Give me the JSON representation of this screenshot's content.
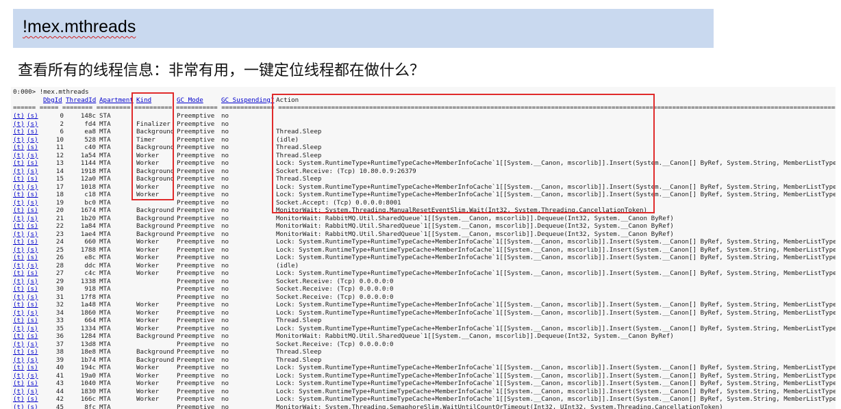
{
  "slide": {
    "title": "!mex.mthreads",
    "subtitle": "查看所有的线程信息：非常有用，一键定位线程都在做什么？"
  },
  "console": {
    "prompt": "0:000> !mex.mthreads",
    "headers": {
      "dbgid": "DbgId",
      "threadid": "ThreadId",
      "apartment": "Apartment",
      "kind": "Kind",
      "gcmode": "GC Mode",
      "gcsuspending": "GC Suspending?",
      "action": "Action"
    },
    "link_t": "(t)",
    "link_s": "(s)",
    "rows": [
      {
        "dbg": "0",
        "tid": "148c",
        "apt": "STA",
        "kind": "",
        "gc": "Preemptive",
        "susp": "no",
        "action": ""
      },
      {
        "dbg": "2",
        "tid": "fd4",
        "apt": "MTA",
        "kind": "Finalizer",
        "gc": "Preemptive",
        "susp": "no",
        "action": ""
      },
      {
        "dbg": "6",
        "tid": "ea8",
        "apt": "MTA",
        "kind": "Background",
        "gc": "Preemptive",
        "susp": "no",
        "action": "Thread.Sleep"
      },
      {
        "dbg": "10",
        "tid": "528",
        "apt": "MTA",
        "kind": "Timer",
        "gc": "Preemptive",
        "susp": "no",
        "action": "(idle)"
      },
      {
        "dbg": "11",
        "tid": "c40",
        "apt": "MTA",
        "kind": "Background",
        "gc": "Preemptive",
        "susp": "no",
        "action": "Thread.Sleep"
      },
      {
        "dbg": "12",
        "tid": "1a54",
        "apt": "MTA",
        "kind": "Worker",
        "gc": "Preemptive",
        "susp": "no",
        "action": "Thread.Sleep"
      },
      {
        "dbg": "13",
        "tid": "1144",
        "apt": "MTA",
        "kind": "Worker",
        "gc": "Preemptive",
        "susp": "no",
        "action": "Lock: System.RuntimeType+RuntimeTypeCache+MemberInfoCache`1[[System.__Canon, mscorlib]].Insert(System.__Canon[] ByRef, System.String, MemberListType)"
      },
      {
        "dbg": "14",
        "tid": "1918",
        "apt": "MTA",
        "kind": "Background",
        "gc": "Preemptive",
        "susp": "no",
        "action": "Socket.Receive: (Tcp) 10.80.0.9:26379"
      },
      {
        "dbg": "15",
        "tid": "12a0",
        "apt": "MTA",
        "kind": "Background",
        "gc": "Preemptive",
        "susp": "no",
        "action": "Thread.Sleep"
      },
      {
        "dbg": "17",
        "tid": "1018",
        "apt": "MTA",
        "kind": "Worker",
        "gc": "Preemptive",
        "susp": "no",
        "action": "Lock: System.RuntimeType+RuntimeTypeCache+MemberInfoCache`1[[System.__Canon, mscorlib]].Insert(System.__Canon[] ByRef, System.String, MemberListType)"
      },
      {
        "dbg": "18",
        "tid": "c18",
        "apt": "MTA",
        "kind": "Worker",
        "gc": "Preemptive",
        "susp": "no",
        "action": "Lock: System.RuntimeType+RuntimeTypeCache+MemberInfoCache`1[[System.__Canon, mscorlib]].Insert(System.__Canon[] ByRef, System.String, MemberListType)"
      },
      {
        "dbg": "19",
        "tid": "bc0",
        "apt": "MTA",
        "kind": "",
        "gc": "Preemptive",
        "susp": "no",
        "action": "Socket.Accept: (Tcp) 0.0.0.0:8001"
      },
      {
        "dbg": "20",
        "tid": "1674",
        "apt": "MTA",
        "kind": "Background",
        "gc": "Preemptive",
        "susp": "no",
        "action": "MonitorWait: System.Threading.ManualResetEventSlim.Wait(Int32, System.Threading.CancellationToken)"
      },
      {
        "dbg": "21",
        "tid": "1b20",
        "apt": "MTA",
        "kind": "Background",
        "gc": "Preemptive",
        "susp": "no",
        "action": "MonitorWait: RabbitMQ.Util.SharedQueue`1[[System.__Canon, mscorlib]].Dequeue(Int32, System.__Canon ByRef)"
      },
      {
        "dbg": "22",
        "tid": "1a84",
        "apt": "MTA",
        "kind": "Background",
        "gc": "Preemptive",
        "susp": "no",
        "action": "MonitorWait: RabbitMQ.Util.SharedQueue`1[[System.__Canon, mscorlib]].Dequeue(Int32, System.__Canon ByRef)"
      },
      {
        "dbg": "23",
        "tid": "1ae4",
        "apt": "MTA",
        "kind": "Background",
        "gc": "Preemptive",
        "susp": "no",
        "action": "MonitorWait: RabbitMQ.Util.SharedQueue`1[[System.__Canon, mscorlib]].Dequeue(Int32, System.__Canon ByRef)"
      },
      {
        "dbg": "24",
        "tid": "660",
        "apt": "MTA",
        "kind": "Worker",
        "gc": "Preemptive",
        "susp": "no",
        "action": "Lock: System.RuntimeType+RuntimeTypeCache+MemberInfoCache`1[[System.__Canon, mscorlib]].Insert(System.__Canon[] ByRef, System.String, MemberListType)"
      },
      {
        "dbg": "25",
        "tid": "1788",
        "apt": "MTA",
        "kind": "Worker",
        "gc": "Preemptive",
        "susp": "no",
        "action": "Lock: System.RuntimeType+RuntimeTypeCache+MemberInfoCache`1[[System.__Canon, mscorlib]].Insert(System.__Canon[] ByRef, System.String, MemberListType)"
      },
      {
        "dbg": "26",
        "tid": "e8c",
        "apt": "MTA",
        "kind": "Worker",
        "gc": "Preemptive",
        "susp": "no",
        "action": "Lock: System.RuntimeType+RuntimeTypeCache+MemberInfoCache`1[[System.__Canon, mscorlib]].Insert(System.__Canon[] ByRef, System.String, MemberListType)"
      },
      {
        "dbg": "28",
        "tid": "ddc",
        "apt": "MTA",
        "kind": "Worker",
        "gc": "Preemptive",
        "susp": "no",
        "action": "(idle)"
      },
      {
        "dbg": "27",
        "tid": "c4c",
        "apt": "MTA",
        "kind": "Worker",
        "gc": "Preemptive",
        "susp": "no",
        "action": "Lock: System.RuntimeType+RuntimeTypeCache+MemberInfoCache`1[[System.__Canon, mscorlib]].Insert(System.__Canon[] ByRef, System.String, MemberListType)"
      },
      {
        "dbg": "29",
        "tid": "1338",
        "apt": "MTA",
        "kind": "",
        "gc": "Preemptive",
        "susp": "no",
        "action": "Socket.Receive: (Tcp) 0.0.0.0:0"
      },
      {
        "dbg": "30",
        "tid": "918",
        "apt": "MTA",
        "kind": "",
        "gc": "Preemptive",
        "susp": "no",
        "action": "Socket.Receive: (Tcp) 0.0.0.0:0"
      },
      {
        "dbg": "31",
        "tid": "17f8",
        "apt": "MTA",
        "kind": "",
        "gc": "Preemptive",
        "susp": "no",
        "action": "Socket.Receive: (Tcp) 0.0.0.0:0"
      },
      {
        "dbg": "32",
        "tid": "1a48",
        "apt": "MTA",
        "kind": "Worker",
        "gc": "Preemptive",
        "susp": "no",
        "action": "Lock: System.RuntimeType+RuntimeTypeCache+MemberInfoCache`1[[System.__Canon, mscorlib]].Insert(System.__Canon[] ByRef, System.String, MemberListType)"
      },
      {
        "dbg": "34",
        "tid": "1860",
        "apt": "MTA",
        "kind": "Worker",
        "gc": "Preemptive",
        "susp": "no",
        "action": "Lock: System.RuntimeType+RuntimeTypeCache+MemberInfoCache`1[[System.__Canon, mscorlib]].Insert(System.__Canon[] ByRef, System.String, MemberListType)"
      },
      {
        "dbg": "33",
        "tid": "664",
        "apt": "MTA",
        "kind": "Worker",
        "gc": "Preemptive",
        "susp": "no",
        "action": "Thread.Sleep"
      },
      {
        "dbg": "35",
        "tid": "1334",
        "apt": "MTA",
        "kind": "Worker",
        "gc": "Preemptive",
        "susp": "no",
        "action": "Lock: System.RuntimeType+RuntimeTypeCache+MemberInfoCache`1[[System.__Canon, mscorlib]].Insert(System.__Canon[] ByRef, System.String, MemberListType)"
      },
      {
        "dbg": "36",
        "tid": "1284",
        "apt": "MTA",
        "kind": "Background",
        "gc": "Preemptive",
        "susp": "no",
        "action": "MonitorWait: RabbitMQ.Util.SharedQueue`1[[System.__Canon, mscorlib]].Dequeue(Int32, System.__Canon ByRef)"
      },
      {
        "dbg": "37",
        "tid": "13d8",
        "apt": "MTA",
        "kind": "",
        "gc": "Preemptive",
        "susp": "no",
        "action": "Socket.Receive: (Tcp) 0.0.0.0:0"
      },
      {
        "dbg": "38",
        "tid": "18e8",
        "apt": "MTA",
        "kind": "Background",
        "gc": "Preemptive",
        "susp": "no",
        "action": "Thread.Sleep"
      },
      {
        "dbg": "39",
        "tid": "1b74",
        "apt": "MTA",
        "kind": "Background",
        "gc": "Preemptive",
        "susp": "no",
        "action": "Thread.Sleep"
      },
      {
        "dbg": "40",
        "tid": "194c",
        "apt": "MTA",
        "kind": "Worker",
        "gc": "Preemptive",
        "susp": "no",
        "action": "Lock: System.RuntimeType+RuntimeTypeCache+MemberInfoCache`1[[System.__Canon, mscorlib]].Insert(System.__Canon[] ByRef, System.String, MemberListType)"
      },
      {
        "dbg": "41",
        "tid": "19a0",
        "apt": "MTA",
        "kind": "Worker",
        "gc": "Preemptive",
        "susp": "no",
        "action": "Lock: System.RuntimeType+RuntimeTypeCache+MemberInfoCache`1[[System.__Canon, mscorlib]].Insert(System.__Canon[] ByRef, System.String, MemberListType)"
      },
      {
        "dbg": "43",
        "tid": "1040",
        "apt": "MTA",
        "kind": "Worker",
        "gc": "Preemptive",
        "susp": "no",
        "action": "Lock: System.RuntimeType+RuntimeTypeCache+MemberInfoCache`1[[System.__Canon, mscorlib]].Insert(System.__Canon[] ByRef, System.String, MemberListType)"
      },
      {
        "dbg": "44",
        "tid": "1830",
        "apt": "MTA",
        "kind": "Worker",
        "gc": "Preemptive",
        "susp": "no",
        "action": "Lock: System.RuntimeType+RuntimeTypeCache+MemberInfoCache`1[[System.__Canon, mscorlib]].Insert(System.__Canon[] ByRef, System.String, MemberListType)"
      },
      {
        "dbg": "42",
        "tid": "166c",
        "apt": "MTA",
        "kind": "Worker",
        "gc": "Preemptive",
        "susp": "no",
        "action": "Lock: System.RuntimeType+RuntimeTypeCache+MemberInfoCache`1[[System.__Canon, mscorlib]].Insert(System.__Canon[] ByRef, System.String, MemberListType)"
      },
      {
        "dbg": "45",
        "tid": "8fc",
        "apt": "MTA",
        "kind": "",
        "gc": "Preemptive",
        "susp": "no",
        "action": "MonitorWait: System.Threading.SemaphoreSlim.WaitUntilCountOrTimeout(Int32, UInt32, System.Threading.CancellationToken)"
      }
    ]
  },
  "colors": {
    "title_bar_bg": "#c9d9ef",
    "highlight_box": "#e02a2a",
    "link": "#0000cc"
  }
}
